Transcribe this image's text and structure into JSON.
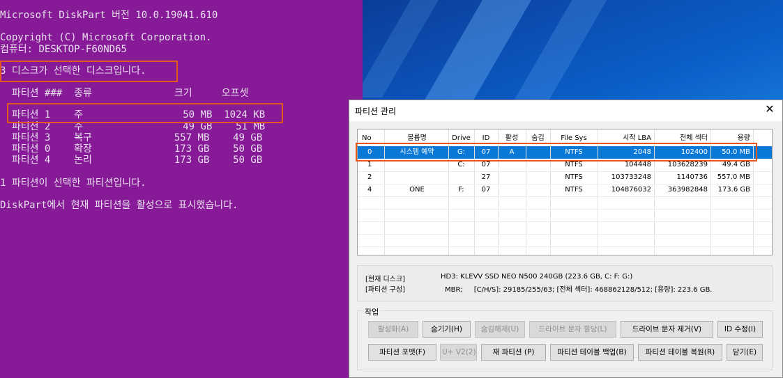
{
  "console": {
    "lines": [
      "Microsoft DiskPart 버전 10.0.19041.610",
      "Copyright (C) Microsoft Corporation.",
      "컴퓨터: DESKTOP-F60ND65",
      "3 디스크가 선택한 디스크입니다.",
      "  파티션 ###  종류              크기     오프셋",
      "  파티션 1    주                 50 MB  1024 KB",
      "  파티션 2    주                 49 GB    51 MB",
      "  파티션 3    복구              557 MB    49 GB",
      "  파티션 0    확장              173 GB    50 GB",
      "  파티션 4    논리              173 GB    50 GB",
      "1 파티션이 선택한 파티션입니다.",
      "DiskPart에서 현재 파티션을 활성으로 표시했습니다."
    ]
  },
  "dialog": {
    "title": "파티션 관리",
    "close_icon": "close-icon",
    "columns": [
      "No",
      "볼륨명",
      "Drive",
      "ID",
      "활성",
      "숨김",
      "File Sys",
      "시작 LBA",
      "전체 섹터",
      "용량"
    ],
    "rows": [
      [
        "0",
        "시스템 예약",
        "G:",
        "07",
        "A",
        "",
        "NTFS",
        "2048",
        "102400",
        "50.0 MB"
      ],
      [
        "1",
        "",
        "C:",
        "07",
        "",
        "",
        "NTFS",
        "104448",
        "103628239",
        "49.4 GB"
      ],
      [
        "2",
        "",
        "",
        "27",
        "",
        "",
        "NTFS",
        "103733248",
        "1140736",
        "557.0 MB"
      ],
      [
        "4",
        "ONE",
        "F:",
        "07",
        "",
        "",
        "NTFS",
        "104876032",
        "363982848",
        "173.6 GB"
      ]
    ],
    "selected_row": 0,
    "info": {
      "disk_label": "[현재 디스크]",
      "disk_value": "HD3: KLEVV SSD NEO N500 240GB (223.6 GB, C: F: G:)",
      "layout_label": "[파티션 구성]",
      "layout_value": "MBR;     [C/H/S]: 29185/255/63; [전체 섹터]: 468862128/512; [용량]: 223.6 GB."
    },
    "group_label": "작업",
    "buttons_row1": [
      {
        "label": "활성화(A)",
        "enabled": false
      },
      {
        "label": "숨기기(H)",
        "enabled": true
      },
      {
        "label": "숨김해제(U)",
        "enabled": false
      },
      {
        "label": "드라이브 문자 할당(L)",
        "enabled": false
      },
      {
        "label": "드라이브 문자 제거(V)",
        "enabled": true
      },
      {
        "label": "ID 수정(I)",
        "enabled": true
      }
    ],
    "buttons_row2": [
      {
        "label": "파티션 포맷(F)",
        "enabled": true
      },
      {
        "label": "U+ V2(2)",
        "enabled": false
      },
      {
        "label": "재 파티션 (P)",
        "enabled": true
      },
      {
        "label": "파티션 테이블 백업(B)",
        "enabled": true
      },
      {
        "label": "파티션 테이블 복원(R)",
        "enabled": true
      },
      {
        "label": "닫기(E)",
        "enabled": true
      }
    ]
  },
  "colors": {
    "console_bg": "#871a97",
    "highlight_box": "#e2571c",
    "selected_row": "#0a78d7"
  }
}
